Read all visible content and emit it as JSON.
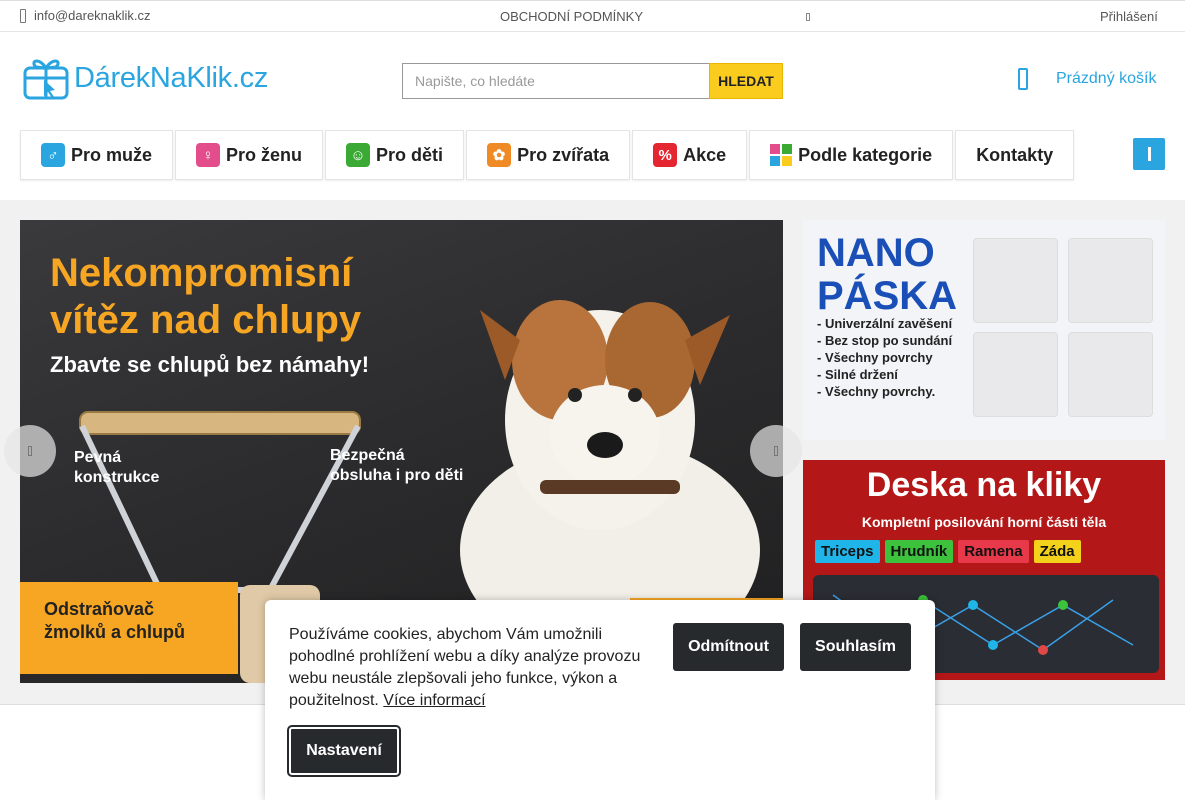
{
  "topbar": {
    "email": "info@dareknaklik.cz",
    "terms": "OBCHODNÍ PODMÍNKY",
    "login": "Přihlášení"
  },
  "header": {
    "logo_text": "DárekNaKlik.cz",
    "search_placeholder": "Napište, co hledáte",
    "search_button": "HLEDAT",
    "cart_label": "Prázdný košík"
  },
  "nav": {
    "items": [
      {
        "label": "Pro muže",
        "icon": "male-icon",
        "color": "#2aa5df"
      },
      {
        "label": "Pro ženu",
        "icon": "female-icon",
        "color": "#e44d8b"
      },
      {
        "label": "Pro děti",
        "icon": "child-icon",
        "color": "#3aaa35"
      },
      {
        "label": "Pro zvířata",
        "icon": "paw-icon",
        "color": "#f08a24"
      },
      {
        "label": "Akce",
        "icon": "percent-icon",
        "color": "#e3262f"
      },
      {
        "label": "Podle kategorie",
        "icon": "grid-icon",
        "color": "#2aa5df"
      },
      {
        "label": "Kontakty",
        "icon": "",
        "color": ""
      }
    ]
  },
  "main_banner": {
    "headline_line1": "Nekompromisní",
    "headline_line2": "vítěz nad chlupy",
    "subheadline": "Zbavte se chlupů bez námahy!",
    "label_left_1": "Pevná",
    "label_left_2": "konstrukce",
    "label_right_1": "Bezpečná",
    "label_right_2": "obsluha i pro děti",
    "tag_line1": "Odstraňovač",
    "tag_line2": "žmolků a chlupů"
  },
  "side_banner_1": {
    "title_line1": "NANO",
    "title_line2": "PÁSKA",
    "bullets": [
      "- Univerzální zavěšení",
      "- Bez stop po sundání",
      "- Všechny povrchy",
      "- Silné držení",
      "- Všechny povrchy."
    ]
  },
  "side_banner_2": {
    "title": "Deska na kliky",
    "subtitle": "Kompletní posilování horní části těla",
    "tags": [
      {
        "label": "Triceps",
        "color": "#1fb5e8"
      },
      {
        "label": "Hrudník",
        "color": "#3cc23c"
      },
      {
        "label": "Ramena",
        "color": "#e8394a"
      },
      {
        "label": "Záda",
        "color": "#f4d21b"
      }
    ]
  },
  "cookie": {
    "message": "Používáme cookies, abychom Vám umožnili pohodlné prohlížení webu a díky analýze provozu webu neustále zlepšovali jeho funkce, výkon a použitelnost.",
    "more_info": "Více informací",
    "reject": "Odmítnout",
    "accept": "Souhlasím",
    "settings": "Nastavení"
  },
  "colors": {
    "brand_blue": "#2aa5df",
    "search_yellow": "#f9cc1d",
    "banner_orange": "#f6a623",
    "dark_button": "#262a2d"
  }
}
